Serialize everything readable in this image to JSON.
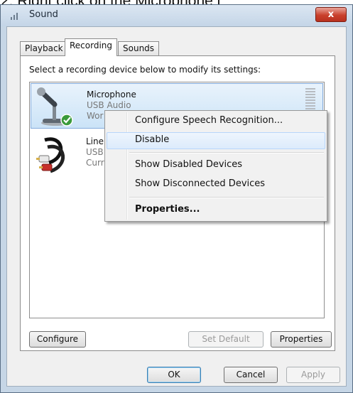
{
  "caption": "2. Right click on the Microphone i",
  "window": {
    "title": "Sound",
    "close_glyph": "x",
    "icon": "speaker-icon"
  },
  "tabs": [
    {
      "label": "Playback",
      "active": false
    },
    {
      "label": "Recording",
      "active": true
    },
    {
      "label": "Sounds",
      "active": false
    }
  ],
  "recording": {
    "instruction": "Select a recording device below to modify its settings:",
    "devices": [
      {
        "name": "Microphone",
        "line2": "USB Audio",
        "line3": "Wor",
        "icon": "microphone-icon",
        "status_icon": "green-checkmark-icon",
        "selected": true
      },
      {
        "name": "Line",
        "line2": "USB",
        "line3": "Curr",
        "icon": "rca-cable-icon",
        "selected": false
      }
    ]
  },
  "context_menu": {
    "items": [
      {
        "label": "Configure Speech Recognition...",
        "bold": false,
        "hover": false
      },
      {
        "label": "Disable",
        "bold": false,
        "hover": true
      },
      {
        "label": "Show Disabled Devices",
        "bold": false,
        "hover": false
      },
      {
        "label": "Show Disconnected Devices",
        "bold": false,
        "hover": false
      },
      {
        "label": "Properties...",
        "bold": true,
        "hover": false
      }
    ]
  },
  "buttons": {
    "configure": "Configure",
    "set_default": "Set Default",
    "properties": "Properties",
    "ok": "OK",
    "cancel": "Cancel",
    "apply": "Apply"
  },
  "colors": {
    "window_frame": "#c6d6e6",
    "selection": "#cbe3f7",
    "close_button": "#c9402c",
    "status_ok": "#3a9a3a"
  }
}
